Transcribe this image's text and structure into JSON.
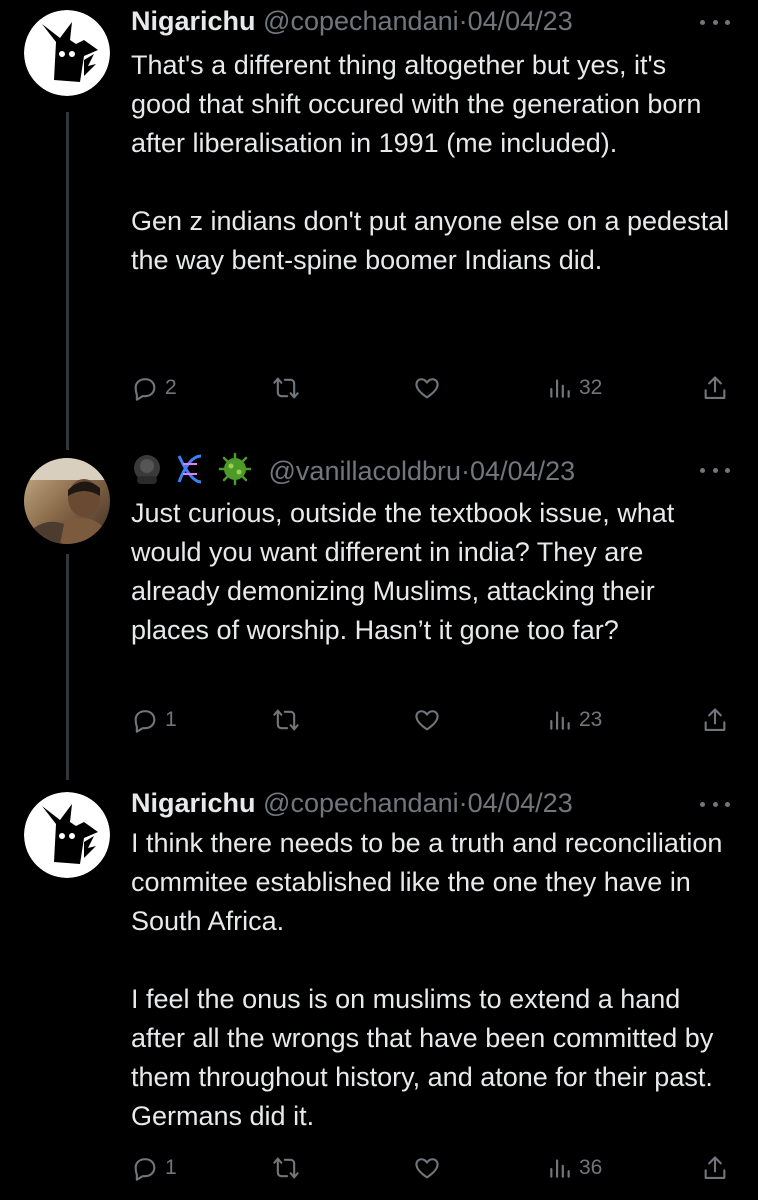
{
  "tweets": [
    {
      "name": "Nigarichu",
      "handle": "@copechandani",
      "separator": "·",
      "date": "04/04/23",
      "text": "That's a different thing altogether but yes, it's good that shift occured with the generation born after liberalisation in 1991 (me included).\n\nGen z indians don't put anyone else on a pedestal the way bent-spine boomer Indians did.",
      "replies": "2",
      "retweets": "",
      "likes": "",
      "views": "32",
      "avatar_icon": "pikachu-silhouette-icon"
    },
    {
      "name": "🦍🧬🦠",
      "handle": "@vanillacoldbru",
      "separator": "·",
      "date": "04/04/23",
      "text": "Just curious, outside the textbook issue, what would you want different in india? They are already demonizing Muslims, attacking their places of worship. Hasn’t it gone too far?",
      "replies": "1",
      "retweets": "",
      "likes": "",
      "views": "23",
      "avatar_icon": "user-photo"
    },
    {
      "name": "Nigarichu",
      "handle": "@copechandani",
      "separator": "·",
      "date": "04/04/23",
      "text": "I think there needs to be a truth and reconciliation commitee established like the one they have in South Africa.\n\nI feel the onus is on muslims to extend a hand after all the wrongs that have been committed by them throughout history, and atone for their past. Germans did it.",
      "replies": "1",
      "retweets": "",
      "likes": "",
      "views": "36",
      "avatar_icon": "pikachu-silhouette-icon"
    }
  ],
  "colors": {
    "background": "#000000",
    "text": "#e7e9ea",
    "secondary": "#71767b",
    "thread_line": "#333639"
  }
}
